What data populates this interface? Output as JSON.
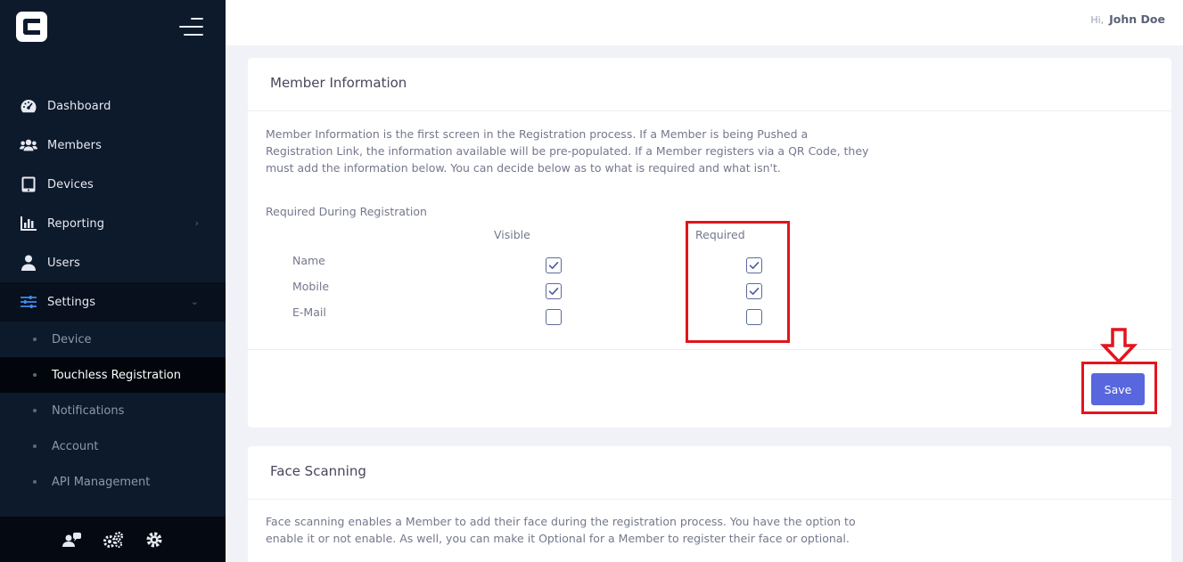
{
  "sidebar": {
    "menu": [
      {
        "label": "Dashboard",
        "icon": "dashboard-gauge-icon"
      },
      {
        "label": "Members",
        "icon": "members-group-icon"
      },
      {
        "label": "Devices",
        "icon": "tablet-icon"
      },
      {
        "label": "Reporting",
        "icon": "bar-chart-icon",
        "expandable": true
      },
      {
        "label": "Users",
        "icon": "user-icon"
      },
      {
        "label": "Settings",
        "icon": "sliders-icon",
        "expanded": true
      }
    ],
    "submenu": [
      {
        "label": "Device"
      },
      {
        "label": "Touchless Registration",
        "active": true
      },
      {
        "label": "Notifications"
      },
      {
        "label": "Account"
      },
      {
        "label": "API Management"
      }
    ],
    "footer_icons": [
      "user-chat-icon",
      "gears-icon",
      "gear-icon"
    ]
  },
  "header": {
    "greeting": "Hi,",
    "user_name": "John Doe"
  },
  "member_info": {
    "title": "Member Information",
    "description": "Member Information is the first screen in the Registration process. If a Member is being Pushed a Registration Link, the information available will be pre-populated. If a Member registers via a QR Code, they must add the information below. You can decide below as to what is required and what isn't.",
    "section_label": "Required During Registration",
    "col_visible": "Visible",
    "col_required": "Required",
    "fields": [
      {
        "label": "Name",
        "visible": true,
        "required": true
      },
      {
        "label": "Mobile",
        "visible": true,
        "required": true
      },
      {
        "label": "E-Mail",
        "visible": false,
        "required": false
      }
    ],
    "save_label": "Save"
  },
  "face_scanning": {
    "title": "Face Scanning",
    "description": "Face scanning enables a Member to add their face during the registration process. You have the option to enable it or not enable. As well, you can make it Optional for a Member to register their face or optional."
  },
  "colors": {
    "sidebar_bg": "#0d1a2c",
    "accent": "#5867dd",
    "annotation": "#e3141d"
  }
}
